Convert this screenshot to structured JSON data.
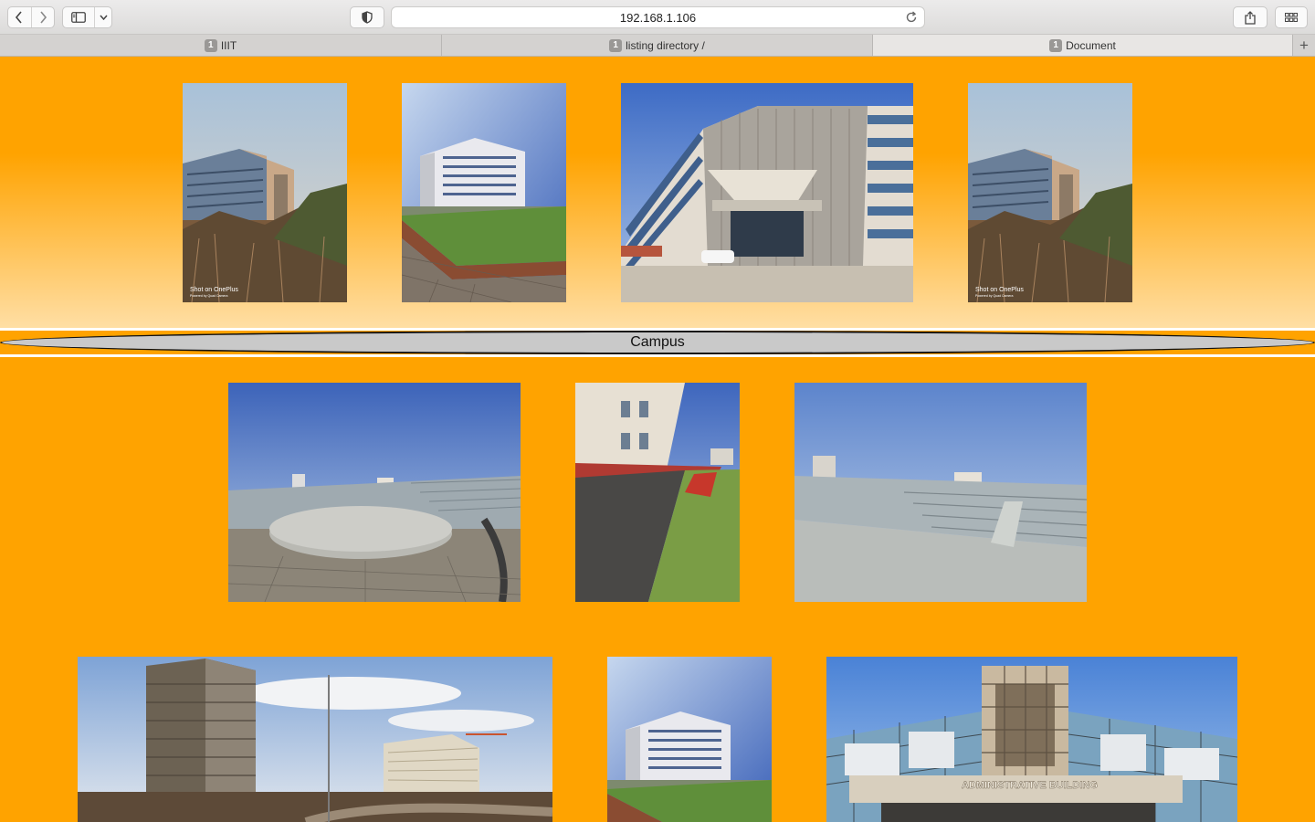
{
  "browser": {
    "address": "192.168.1.106",
    "tabs": [
      {
        "count": "1",
        "label": "IIIT",
        "active": false
      },
      {
        "count": "1",
        "label": "listing directory /",
        "active": false
      },
      {
        "count": "1",
        "label": "Document",
        "active": true
      }
    ],
    "icons": [
      "back-icon",
      "forward-icon",
      "sidebar-icon",
      "chevron-down-icon",
      "shield-icon",
      "reload-icon",
      "share-icon",
      "tab-overview-icon",
      "plus-icon"
    ]
  },
  "page": {
    "section_heading": "Campus",
    "watermark_line1": "Shot on OnePlus",
    "watermark_line2": "Powered by Quad Camera",
    "sign_text": "ADMINISTRATIVE BUILDING",
    "colors": {
      "background": "#ffa300",
      "banner": "#c9c9c9"
    }
  }
}
